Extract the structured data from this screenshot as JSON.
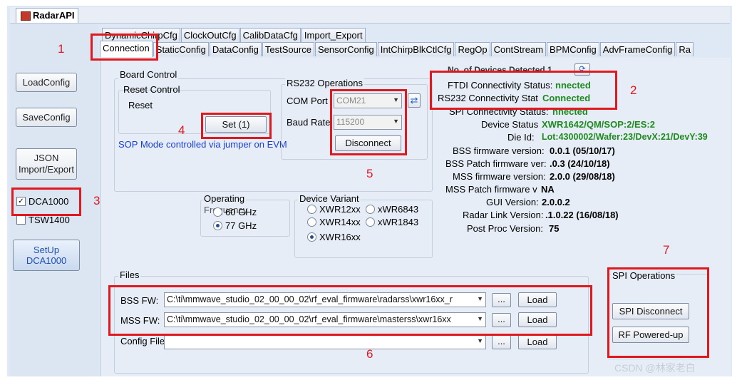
{
  "window": {
    "title": "RadarAPI"
  },
  "tabs_row1": [
    "DynamicChirpCfg",
    "ClockOutCfg",
    "CalibDataCfg",
    "Import_Export"
  ],
  "tabs_row2": [
    "Connection",
    "StaticConfig",
    "DataConfig",
    "TestSource",
    "SensorConfig",
    "IntChirpBlkCtlCfg",
    "RegOp",
    "ContStream",
    "BPMConfig",
    "AdvFrameConfig",
    "Ra"
  ],
  "sidebar": {
    "load_config": "LoadConfig",
    "save_config": "SaveConfig",
    "json_line1": "JSON",
    "json_line2": "Import/Export",
    "dca1000": "DCA1000",
    "tsw1400": "TSW1400",
    "setup_line1": "SetUp",
    "setup_line2": "DCA1000"
  },
  "board_control": {
    "title": "Board Control",
    "reset_control": "Reset Control",
    "reset": "Reset",
    "set_button": "Set (1)",
    "sop_note": "SOP Mode controlled via jumper on EVM"
  },
  "rs232": {
    "title": "RS232 Operations",
    "com_port_label": "COM Port",
    "com_port_value": "COM21",
    "baud_rate_label": "Baud Rate",
    "baud_rate_value": "115200",
    "disconnect": "Disconnect"
  },
  "status": {
    "devices_detected": "No. of Devices Detected 1",
    "ftdi_label": "FTDI Connectivity Status:",
    "ftdi_value": "nnected",
    "rs232_label": "RS232 Connectivity Stat",
    "rs232_value": "Connected",
    "spi_label": "SPI Connectivity Status:",
    "spi_value": "nnected",
    "device_status_label": "Device Status",
    "device_status_value": "XWR1642/QM/SOP:2/ES:2",
    "die_id_label": "Die Id:",
    "die_id_value": "Lot:4300002/Wafer:23/DevX:21/DevY:39",
    "bss_fw_label": "BSS firmware version:",
    "bss_fw_value": "0.0.1 (05/10/17)",
    "bss_patch_label": "BSS Patch firmware ver:",
    "bss_patch_value": ".0.3 (24/10/18)",
    "mss_fw_label": "MSS firmware version:",
    "mss_fw_value": "2.0.0 (29/08/18)",
    "mss_patch_label": "MSS Patch firmware v",
    "mss_patch_value": "NA",
    "gui_label": "GUI Version:",
    "gui_value": "2.0.0.2",
    "radar_link_label": "Radar Link Version:",
    "radar_link_value": ".1.0.22 (16/08/18)",
    "post_proc_label": "Post Proc Version:",
    "post_proc_value": "75"
  },
  "operating_freq": {
    "title": "Operating",
    "title2": "Frequency",
    "opt_60": "60 GHz",
    "opt_77": "77 GHz"
  },
  "device_variant": {
    "title": "Device Variant",
    "opts": [
      "XWR12xx",
      "xWR6843",
      "XWR14xx",
      "xWR1843",
      "XWR16xx"
    ]
  },
  "files": {
    "title": "Files",
    "bss_label": "BSS FW:",
    "bss_path": "C:\\ti\\mmwave_studio_02_00_00_02\\rf_eval_firmware\\radarss\\xwr16xx_r",
    "mss_label": "MSS FW:",
    "mss_path": "C:\\ti\\mmwave_studio_02_00_00_02\\rf_eval_firmware\\masterss\\xwr16xx",
    "config_label": "Config File",
    "browse": "...",
    "load": "Load"
  },
  "spi_ops": {
    "title": "SPI Operations",
    "disconnect": "SPI Disconnect",
    "powered_up": "RF Powered-up"
  },
  "annotations": [
    "1",
    "2",
    "3",
    "4",
    "5",
    "6",
    "7"
  ],
  "watermark": "CSDN @林家老白",
  "colors": {
    "highlight": "#e0191f",
    "status_green": "#1f8a1f",
    "note_blue": "#1a3fd6"
  }
}
